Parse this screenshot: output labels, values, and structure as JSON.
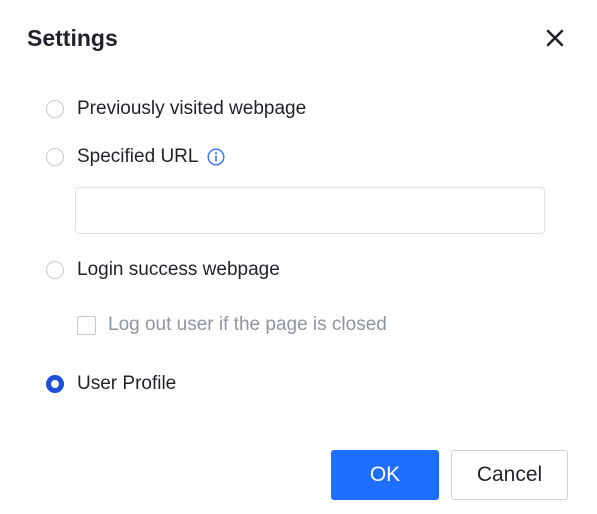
{
  "dialog": {
    "title": "Settings",
    "close_icon": "close-icon"
  },
  "options": [
    {
      "label": "Previously visited webpage",
      "checked": false
    },
    {
      "label": "Specified URL",
      "checked": false,
      "icon": "info-icon"
    },
    {
      "label": "Login success webpage",
      "checked": false
    },
    {
      "label": "User Profile",
      "checked": true
    }
  ],
  "url_input": {
    "value": "",
    "placeholder": ""
  },
  "logout_checkbox": {
    "label": "Log out user if the page is closed",
    "checked": false,
    "disabled": true
  },
  "buttons": {
    "ok_label": "OK",
    "cancel_label": "Cancel"
  },
  "colors": {
    "primary": "#1f6fff",
    "radio_selected": "#1d4fd7",
    "info_icon": "#3370ff",
    "disabled_text": "#8f959e"
  }
}
